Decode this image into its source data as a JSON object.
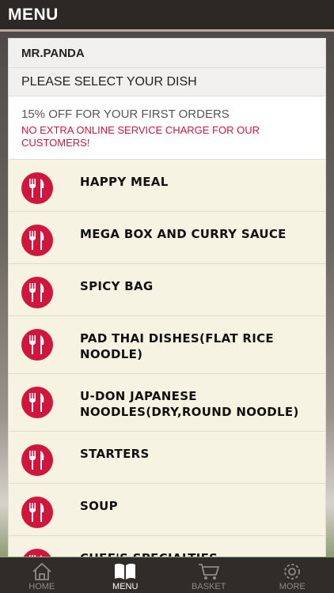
{
  "topbar": {
    "title": "MENU"
  },
  "header": {
    "shop_name": "MR.PANDA",
    "prompt": "PLEASE SELECT YOUR DISH"
  },
  "promo": {
    "line1": "15% OFF FOR YOUR FIRST ORDERS",
    "line2": "NO EXTRA ONLINE SERVICE CHARGE FOR OUR CUSTOMERS!"
  },
  "categories": [
    {
      "label": "HAPPY MEAL",
      "icon": "fork-knife-icon"
    },
    {
      "label": "MEGA BOX AND CURRY SAUCE",
      "icon": "fork-knife-icon"
    },
    {
      "label": "SPICY BAG",
      "icon": "fork-knife-icon"
    },
    {
      "label": "PAD THAI DISHES(FLAT RICE NOODLE)",
      "icon": "fork-knife-icon"
    },
    {
      "label": "U-DON JAPANESE NOODLES(DRY,ROUND NOODLE)",
      "icon": "fork-knife-icon"
    },
    {
      "label": "STARTERS",
      "icon": "fork-knife-icon"
    },
    {
      "label": "SOUP",
      "icon": "fork-knife-icon"
    },
    {
      "label": "CHEF'S SPECIALTIES",
      "icon": "fork-knife-icon"
    }
  ],
  "tabs": [
    {
      "label": "HOME",
      "icon": "home-icon",
      "active": false
    },
    {
      "label": "MENU",
      "icon": "book-icon",
      "active": true
    },
    {
      "label": "BASKET",
      "icon": "cart-icon",
      "active": false
    },
    {
      "label": "MORE",
      "icon": "gear-icon",
      "active": false
    }
  ],
  "colors": {
    "accent": "#d0163d",
    "item_bg": "#f7f3e3",
    "topbar_bg": "#2b2826"
  }
}
